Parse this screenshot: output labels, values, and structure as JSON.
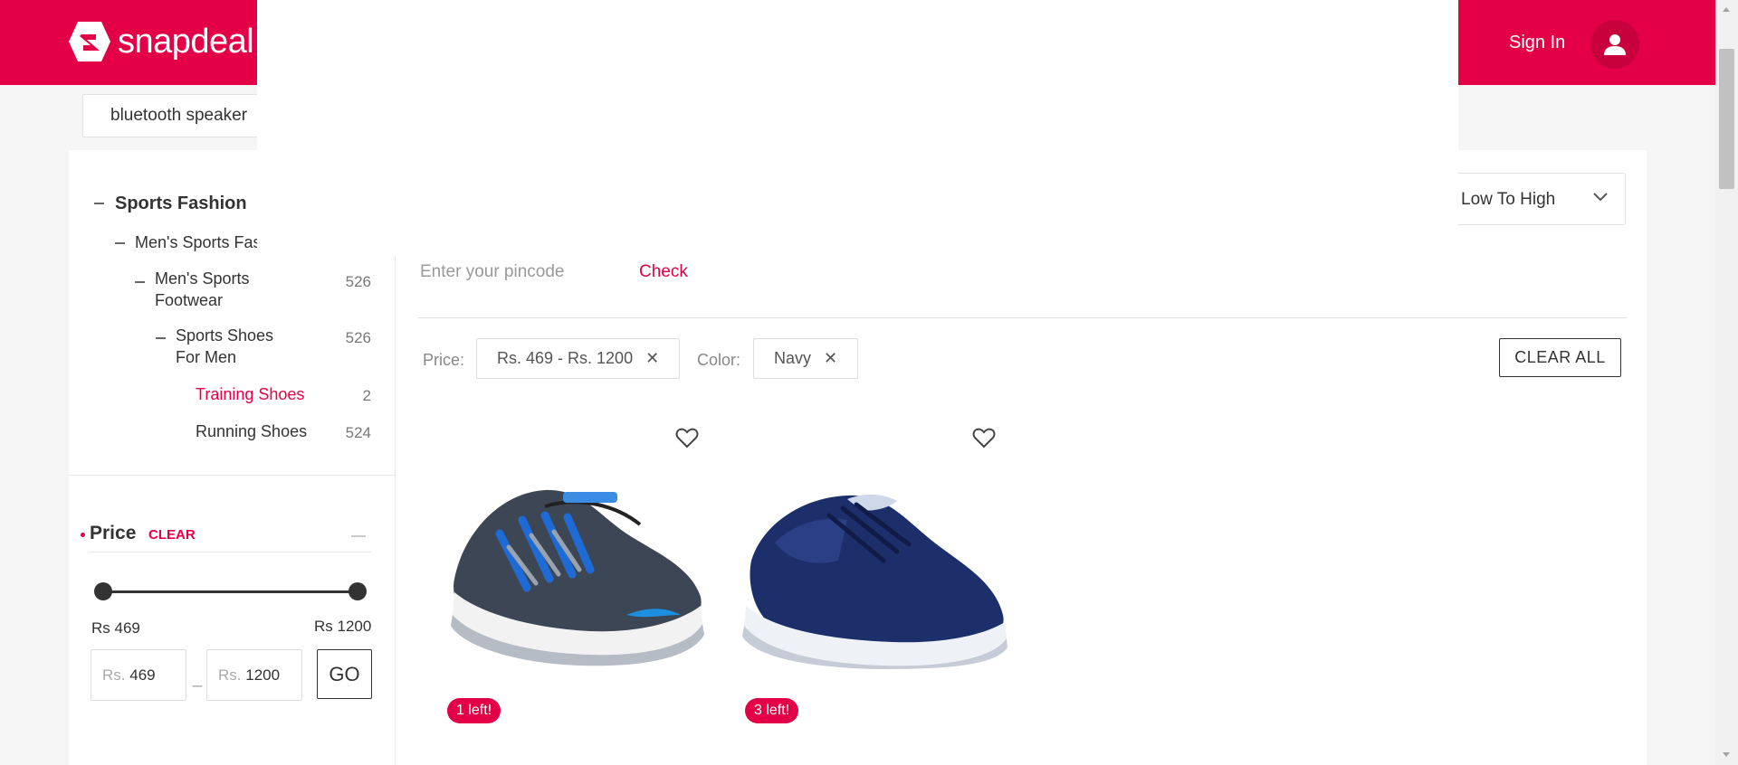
{
  "header": {
    "logo_text": "snapdeal",
    "sign_in_label": "Sign In",
    "brand_color": "#e40046"
  },
  "search": {
    "value": "bluetooth speaker"
  },
  "sort": {
    "selected": "Low To High"
  },
  "categories": {
    "root": "Sports Fashion",
    "level1": "Men's Sports Fas",
    "items": [
      {
        "line1": "Men's Sports",
        "line2": "Footwear",
        "count": "526"
      },
      {
        "line1": "Sports Shoes",
        "line2": "For Men",
        "count": "526"
      },
      {
        "label": "Training Shoes",
        "count": "2",
        "active": true
      },
      {
        "label": "Running Shoes",
        "count": "524"
      }
    ]
  },
  "price_filter": {
    "heading": "Price",
    "clear_label": "CLEAR",
    "min_label": "Rs 469",
    "max_label": "Rs 1200",
    "min_prefix": "Rs.",
    "min_value": "469",
    "max_prefix": "Rs.",
    "max_value": "1200",
    "dash": "_",
    "go_label": "GO"
  },
  "pincode": {
    "placeholder": "Enter your pincode",
    "check_label": "Check"
  },
  "applied_filters": {
    "price_label": "Price:",
    "price_value": "Rs. 469 - Rs. 1200",
    "color_label": "Color:",
    "color_value": "Navy",
    "clear_all_label": "CLEAR ALL"
  },
  "products": [
    {
      "image": "grey-blue-running-shoe",
      "stock": "1 left!"
    },
    {
      "image": "navy-running-shoe",
      "stock": "3 left!"
    }
  ]
}
